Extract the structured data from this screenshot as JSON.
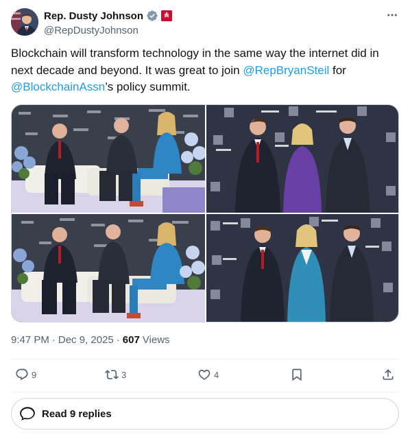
{
  "author": {
    "display_name": "Rep. Dusty Johnson",
    "handle": "@RepDustyJohnson",
    "avatar_icon": "avatar-photo",
    "verified_icon": "verified-badge-icon",
    "gov_badge_icon": "government-affiliation-icon"
  },
  "tweet": {
    "text_before": "Blockchain will transform technology in the same way the internet did in next decade and beyond. It was great to join ",
    "mention_1": "@RepBryanSteil",
    "text_middle": " for ",
    "mention_2": "@BlockchainAssn",
    "text_after": "’s policy summit."
  },
  "media": {
    "photos": [
      {
        "description_icon": "photo-panel-stage"
      },
      {
        "description_icon": "photo-group-purple"
      },
      {
        "description_icon": "photo-panel-stage-2"
      },
      {
        "description_icon": "photo-group-teal"
      }
    ]
  },
  "meta": {
    "time": "9:47 PM",
    "separator": "·",
    "date": "Dec 9, 2025",
    "views_count": "607",
    "views_label": "Views"
  },
  "actions": {
    "reply_count": "9",
    "repost_count": "3",
    "like_count": "4"
  },
  "read_replies": {
    "label": "Read 9 replies"
  },
  "colors": {
    "accent": "#1d9bf0",
    "text_secondary": "#536471",
    "text_primary": "#0f1419",
    "border": "#cfd9de"
  }
}
